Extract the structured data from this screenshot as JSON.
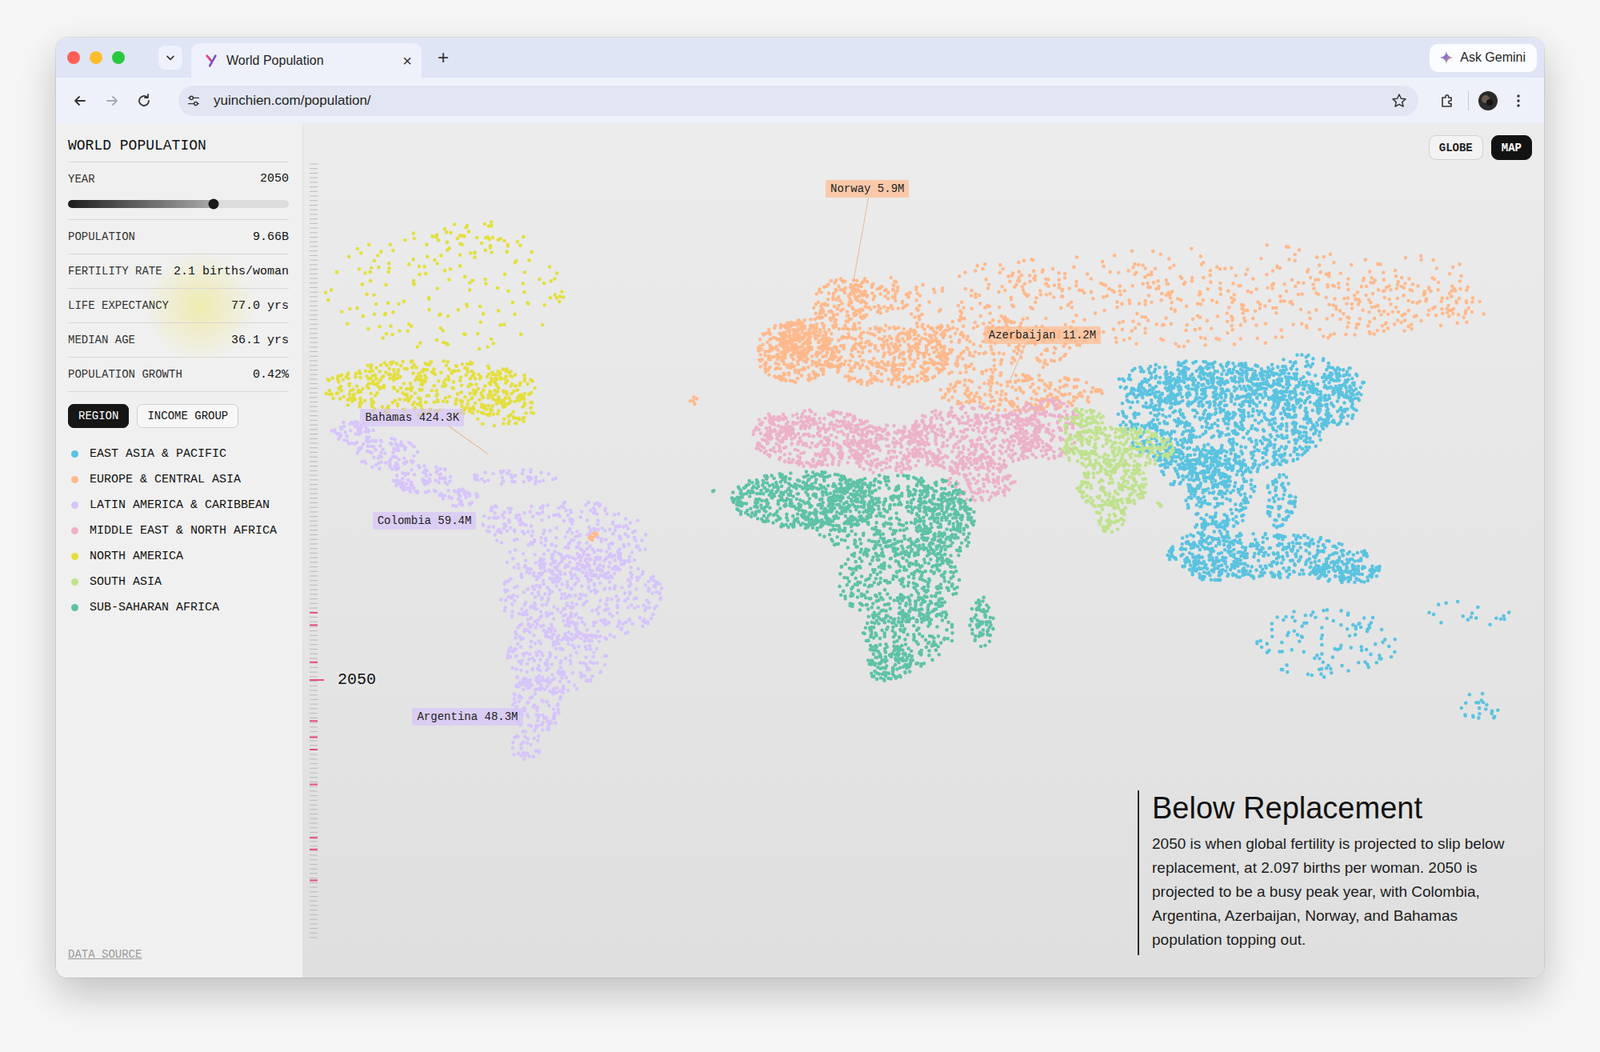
{
  "window": {
    "title": "World Population"
  },
  "browser": {
    "tab": {
      "title": "World Population",
      "close": "×",
      "selected": true
    },
    "new_tab": "+",
    "assistant": "Ask Gemini",
    "url": "yuinchien.com/population/",
    "back_disabled": false,
    "forward_disabled": true
  },
  "sidebar": {
    "title": "WORLD POPULATION",
    "year": {
      "label": "YEAR",
      "value": "2050",
      "level": 0.66
    },
    "stats": [
      {
        "label": "POPULATION",
        "value": "9.66B"
      },
      {
        "label": "FERTILITY RATE",
        "value": "2.1 births/woman"
      },
      {
        "label": "LIFE EXPECTANCY",
        "value": "77.0 yrs"
      },
      {
        "label": "MEDIAN AGE",
        "value": "36.1 yrs"
      },
      {
        "label": "POPULATION GROWTH",
        "value": "0.42%"
      }
    ],
    "group_tabs": [
      {
        "label": "REGION",
        "selected": true
      },
      {
        "label": "INCOME GROUP",
        "selected": false
      }
    ],
    "legend": [
      {
        "label": "EAST ASIA & PACIFIC",
        "color": "#5ac3e0"
      },
      {
        "label": "EUROPE & CENTRAL ASIA",
        "color": "#ffb98c"
      },
      {
        "label": "LATIN AMERICA & CARIBBEAN",
        "color": "#d6c4fa"
      },
      {
        "label": "MIDDLE EAST & NORTH AFRICA",
        "color": "#ecb2c9"
      },
      {
        "label": "NORTH AMERICA",
        "color": "#e3df3c"
      },
      {
        "label": "SOUTH ASIA",
        "color": "#bfe28e"
      },
      {
        "label": "SUB-SAHARAN AFRICA",
        "color": "#5ec2a7"
      }
    ],
    "footer_link": "DATA SOURCE"
  },
  "view_toggle": [
    {
      "label": "GLOBE",
      "selected": false
    },
    {
      "label": "MAP",
      "selected": true
    }
  ],
  "timeline": {
    "label": "2050",
    "level": 0.667,
    "highlights": [
      0.58,
      0.596,
      0.644,
      0.72,
      0.741,
      0.757,
      0.802,
      0.871,
      0.886,
      0.926
    ]
  },
  "map": {
    "labels": [
      {
        "text": "Norway 5.9M",
        "color": "#ffb98c"
      },
      {
        "text": "Azerbaijan 11.2M",
        "color": "#ffb98c"
      },
      {
        "text": "Bahamas 424.3K",
        "color": "#d6c4fa"
      },
      {
        "text": "Colombia 59.4M",
        "color": "#d6c4fa"
      },
      {
        "text": "Argentina 48.3M",
        "color": "#d6c4fa"
      }
    ]
  },
  "story": {
    "title": "Below Replacement",
    "body": "2050 is when global fertility is projected to slip below replacement, at 2.097 births per woman. 2050 is projected to be a busy peak year, with Colombia, Argentina, Azerbaijan, Norway, and Bahamas population topping out."
  }
}
